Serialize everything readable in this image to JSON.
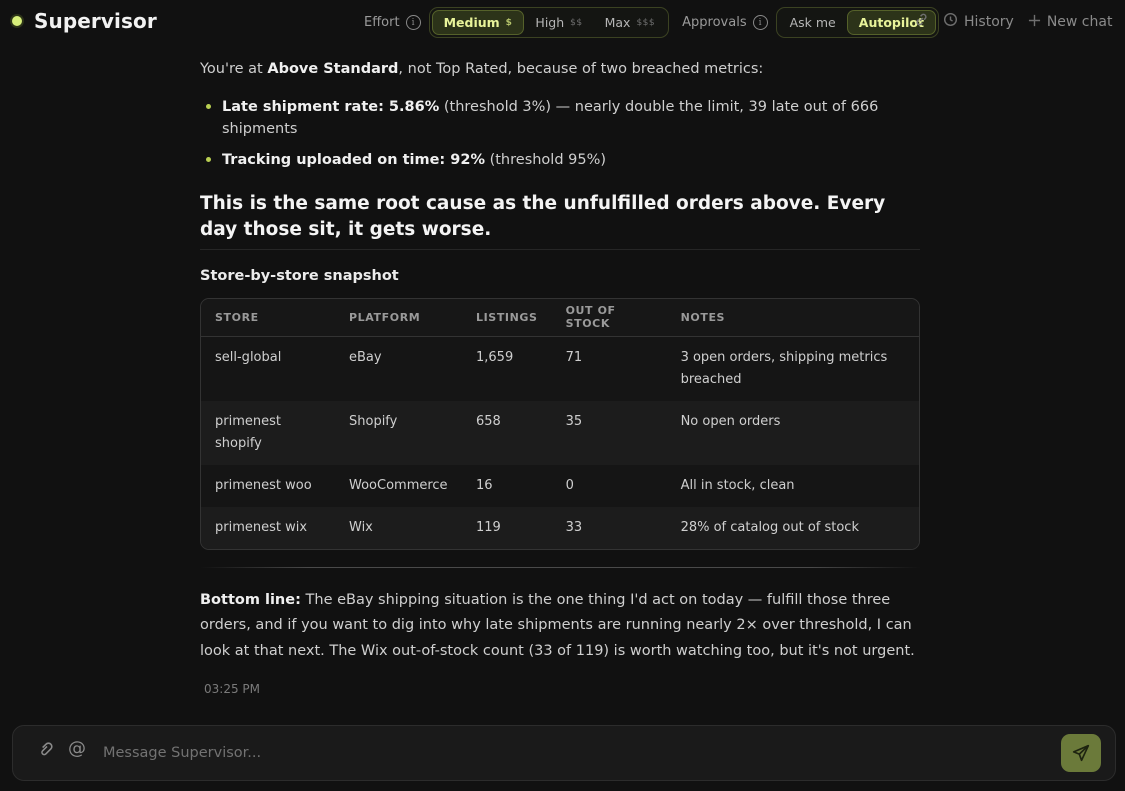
{
  "app": {
    "title": "Supervisor",
    "accent": "#d7ef7a"
  },
  "controls": {
    "effort_label": "Effort",
    "effort_options": [
      {
        "label": "Medium",
        "cost": "$",
        "active": true
      },
      {
        "label": "High",
        "cost": "$$",
        "active": false
      },
      {
        "label": "Max",
        "cost": "$$$",
        "active": false
      }
    ],
    "approvals_label": "Approvals",
    "approval_options": [
      {
        "label": "Ask me",
        "active": false
      },
      {
        "label": "Autopilot",
        "active": true
      }
    ]
  },
  "nav": {
    "history_label": "History",
    "new_chat_label": "New chat"
  },
  "message": {
    "intro_prefix": "You're at ",
    "intro_bold": "Above Standard",
    "intro_suffix": ", not Top Rated, because of two breached metrics:",
    "bullets": [
      {
        "bold": "Late shipment rate: 5.86%",
        "text": " (threshold 3%) — nearly double the limit, 39 late out of 666 shipments"
      },
      {
        "bold": "Tracking uploaded on time: 92%",
        "text": " (threshold 95%)"
      }
    ],
    "headline": "This is the same root cause as the unfulfilled orders above. Every day those sit, it gets worse.",
    "section_title": "Store-by-store snapshot",
    "table": {
      "headers": [
        "STORE",
        "PLATFORM",
        "LISTINGS",
        "OUT OF STOCK",
        "NOTES"
      ],
      "rows": [
        [
          "sell-global",
          "eBay",
          "1,659",
          "71",
          "3 open orders, shipping metrics breached"
        ],
        [
          "primenest shopify",
          "Shopify",
          "658",
          "35",
          "No open orders"
        ],
        [
          "primenest woo",
          "WooCommerce",
          "16",
          "0",
          "All in stock, clean"
        ],
        [
          "primenest wix",
          "Wix",
          "119",
          "33",
          "28% of catalog out of stock"
        ]
      ]
    },
    "bottom_bold": "Bottom line:",
    "bottom_text": " The eBay shipping situation is the one thing I'd act on today — fulfill those three orders, and if you want to dig into why late shipments are running nearly 2× over threshold, I can look at that next. The Wix out-of-stock count (33 of 119) is worth watching too, but it's not urgent.",
    "timestamp": "03:25 PM"
  },
  "composer": {
    "placeholder": "Message Supervisor..."
  }
}
